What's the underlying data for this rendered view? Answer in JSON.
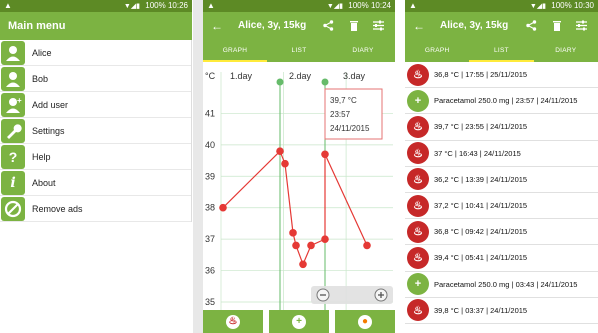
{
  "status_bar": {
    "time_1": "10:26",
    "time_2": "10:24",
    "time_3": "10:30",
    "battery": "100%"
  },
  "menu": {
    "title": "Main menu",
    "items": [
      {
        "label": "Alice",
        "icon": "user-icon"
      },
      {
        "label": "Bob",
        "icon": "user-icon"
      },
      {
        "label": "Add user",
        "icon": "add-user-icon"
      },
      {
        "label": "Settings",
        "icon": "wrench-icon"
      },
      {
        "label": "Help",
        "icon": "question-icon"
      },
      {
        "label": "About",
        "icon": "info-icon"
      },
      {
        "label": "Remove ads",
        "icon": "no-ads-icon"
      }
    ]
  },
  "profile": {
    "title": "Alice, 3y, 15kg"
  },
  "tabs": {
    "graph": "GRAPH",
    "list": "LIST",
    "diary": "DIARY"
  },
  "graph": {
    "unit": "°C",
    "days": [
      "1.day",
      "2.day",
      "3.day"
    ],
    "tooltip": {
      "temp": "39,7 °C",
      "time": "23:57",
      "date": "24/11/2015"
    }
  },
  "chart_data": {
    "type": "line",
    "y_ticks": [
      "41",
      "40",
      "39",
      "38",
      "37",
      "36",
      "35"
    ],
    "ylim": [
      35,
      42
    ],
    "series": [
      {
        "values": [
          38.0,
          39.8,
          39.4,
          37.2,
          36.8,
          36.2,
          36.8,
          37.0,
          39.7,
          36.8
        ]
      }
    ],
    "x_hours": [
      0,
      23,
      24,
      27,
      28.5,
      30,
      32,
      33,
      47.95,
      61
    ],
    "colors": {
      "line": "#e53935",
      "grid": "#c8e6c9",
      "marker": "#66bb6a"
    }
  },
  "list": [
    {
      "kind": "temp",
      "text": "36,8 °C | 17:55 | 25/11/2015"
    },
    {
      "kind": "med",
      "text": "Paracetamol 250.0 mg | 23:57 | 24/11/2015"
    },
    {
      "kind": "temp",
      "text": "39,7 °C | 23:55 | 24/11/2015"
    },
    {
      "kind": "temp",
      "text": "37 °C | 16:43 | 24/11/2015"
    },
    {
      "kind": "temp",
      "text": "36,2 °C | 13:39 | 24/11/2015"
    },
    {
      "kind": "temp",
      "text": "37,2 °C | 10:41 | 24/11/2015"
    },
    {
      "kind": "temp",
      "text": "36,8 °C | 09:42 | 24/11/2015"
    },
    {
      "kind": "temp",
      "text": "39,4 °C | 05:41 | 24/11/2015"
    },
    {
      "kind": "med",
      "text": "Paracetamol 250.0 mg | 03:43 | 24/11/2015"
    },
    {
      "kind": "temp",
      "text": "39,8 °C | 03:37 | 24/11/2015"
    }
  ]
}
